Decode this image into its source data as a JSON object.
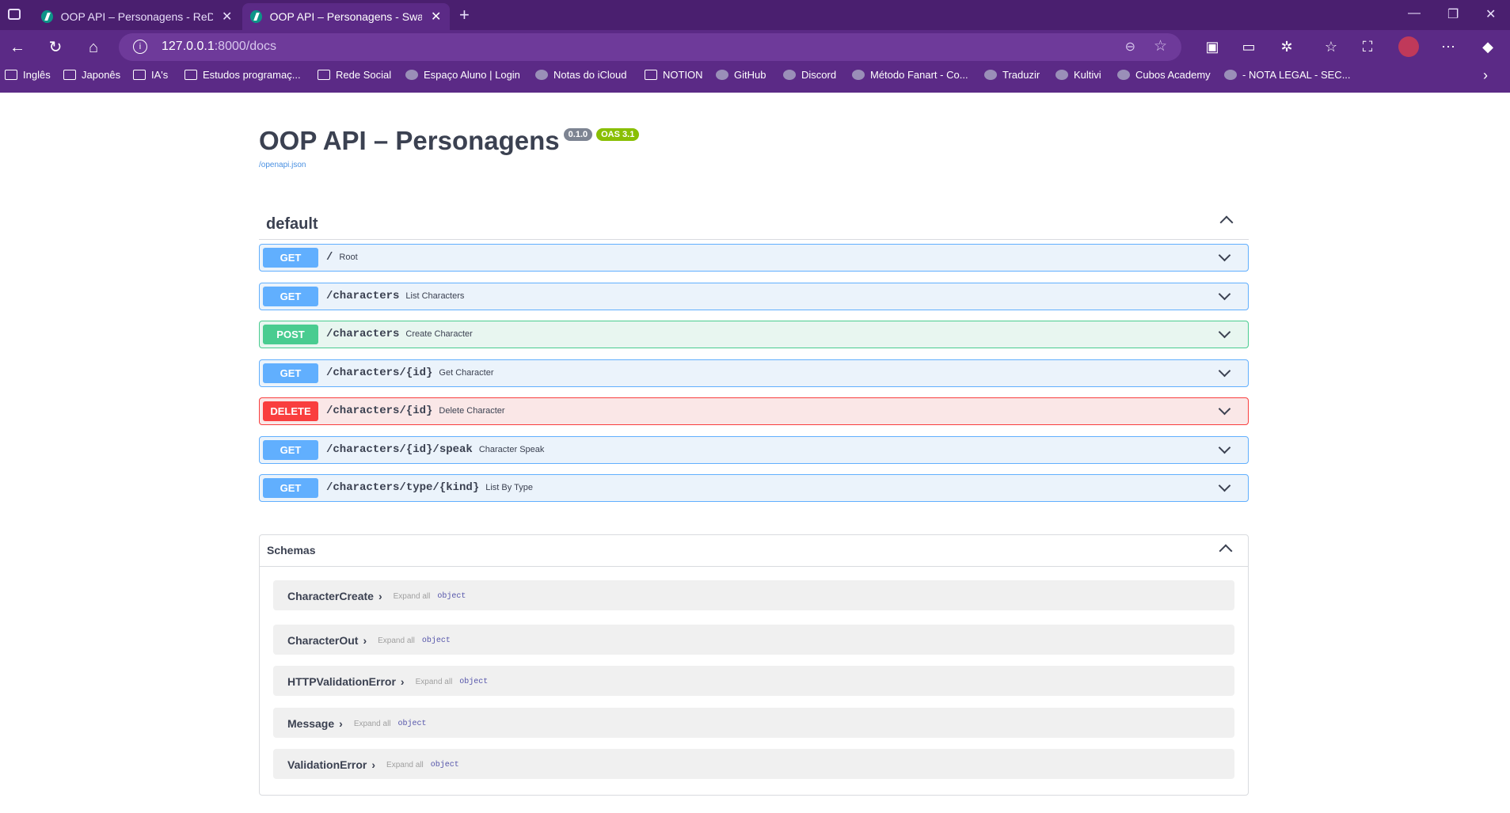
{
  "browser": {
    "tabs": [
      {
        "title": "OOP API – Personagens - ReDoc",
        "close": "✕"
      },
      {
        "title": "OOP API – Personagens - Swagger",
        "close": "✕"
      }
    ],
    "new_tab": "+",
    "url_host": "127.0.0.1",
    "url_path": ":8000/docs",
    "bookmarks": [
      "Inglês",
      "Japonês",
      "IA's",
      "Estudos programaç...",
      "Rede Social",
      "Espaço Aluno | Login",
      "Notas do iCloud",
      "NOTION",
      "GitHub",
      "Discord",
      "Método Fanart - Co...",
      "Traduzir",
      "Kultivi",
      "Cubos Academy",
      "- NOTA LEGAL - SEC..."
    ],
    "accent_color": "#5b2a86"
  },
  "page": {
    "title": "OOP API – Personagens",
    "version_badge": "0.1.0",
    "oas_badge": "OAS 3.1",
    "spec_link": "/openapi.json",
    "section": "default",
    "operations": [
      {
        "method": "GET",
        "path": "/",
        "summary": "Root"
      },
      {
        "method": "GET",
        "path": "/characters",
        "summary": "List Characters"
      },
      {
        "method": "POST",
        "path": "/characters",
        "summary": "Create Character"
      },
      {
        "method": "GET",
        "path": "/characters/{id}",
        "summary": "Get Character"
      },
      {
        "method": "DELETE",
        "path": "/characters/{id}",
        "summary": "Delete Character"
      },
      {
        "method": "GET",
        "path": "/characters/{id}/speak",
        "summary": "Character Speak"
      },
      {
        "method": "GET",
        "path": "/characters/type/{kind}",
        "summary": "List By Type"
      }
    ],
    "schemas_title": "Schemas",
    "schemas": [
      {
        "name": "CharacterCreate",
        "expand": "Expand all",
        "type": "object"
      },
      {
        "name": "CharacterOut",
        "expand": "Expand all",
        "type": "object"
      },
      {
        "name": "HTTPValidationError",
        "expand": "Expand all",
        "type": "object"
      },
      {
        "name": "Message",
        "expand": "Expand all",
        "type": "object"
      },
      {
        "name": "ValidationError",
        "expand": "Expand all",
        "type": "object"
      }
    ],
    "method_colors": {
      "GET": "#61affe",
      "POST": "#49cc90",
      "DELETE": "#f93e3e"
    }
  }
}
